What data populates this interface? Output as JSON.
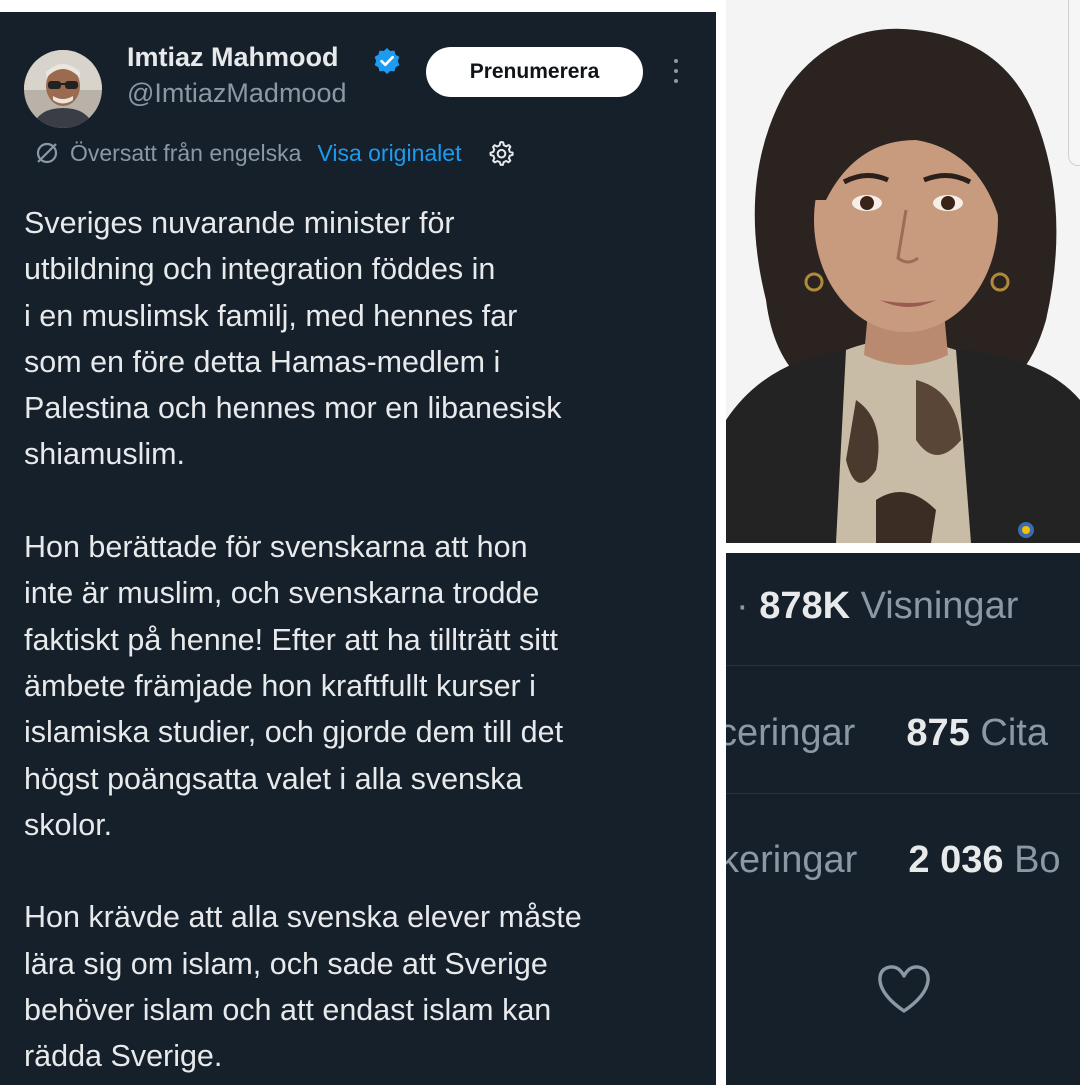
{
  "tweet": {
    "author_name": "Imtiaz Mahmood",
    "author_handle": "@ImtiazMadmood",
    "subscribe_label": "Prenumerera",
    "translation_label": "Översatt från engelska",
    "show_original_label": "Visa originalet",
    "paragraphs": [
      "Sveriges nuvarande minister för\nutbildning och integration föddes in\ni en muslimsk familj, med hennes far\nsom en före detta Hamas-medlem i\nPalestina och hennes mor en libanesisk\nshiamuslim.",
      "Hon berättade för svenskarna att hon\ninte är muslim, och svenskarna trodde\nfaktiskt på henne! Efter att ha tillträtt sitt\nämbete främjade hon kraftfullt kurser i\nislamiska studier, och gjorde dem till det\nhögst poängsatta valet i alla svenska\nskolor.",
      "Hon krävde att alla svenska elever måste\nlära sig om islam, och sade att Sverige\nbehöver islam och att endast islam kan\nrädda Sverige."
    ]
  },
  "stats": {
    "views_prefix": "·",
    "views_value": "878K",
    "views_label": "Visningar",
    "row2_left": "ceringar",
    "row2_value": "875",
    "row2_right": "Cita",
    "row3_left": "keringar",
    "row3_value": "2 036",
    "row3_right": "Bo"
  },
  "icons": {
    "verified": "verified-badge-icon",
    "translate": "translate-icon",
    "settings": "gear-icon",
    "more": "more-vertical-icon",
    "like": "heart-icon"
  },
  "colors": {
    "background_dark": "#15202b",
    "text_primary": "#e7e9ea",
    "text_secondary": "#8b98a5",
    "link": "#1d9bf0"
  }
}
